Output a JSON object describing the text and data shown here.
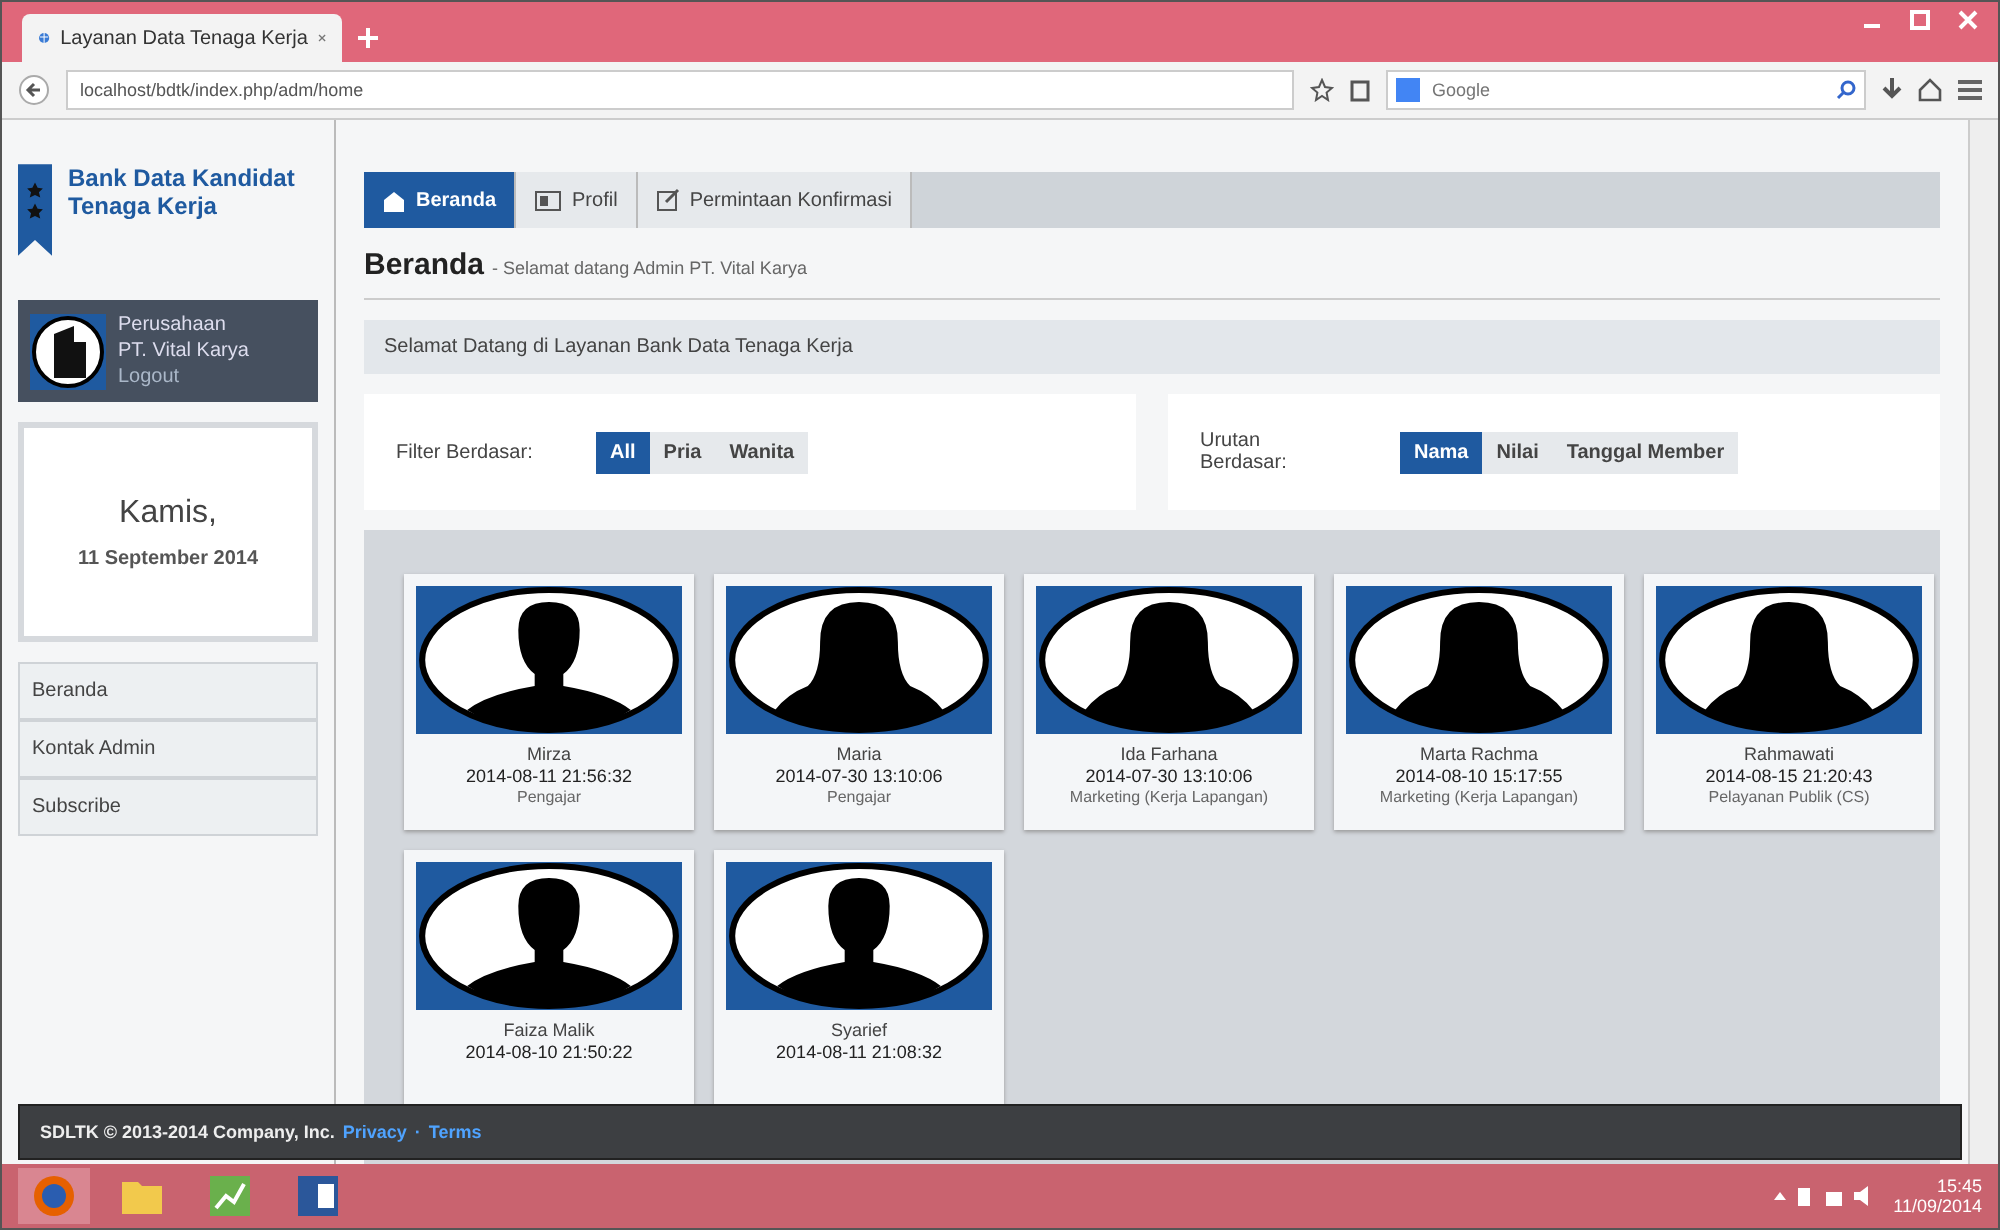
{
  "browser": {
    "tab_title": "Layanan Data Tenaga Kerja",
    "url": "localhost/bdtk/index.php/adm/home",
    "search_placeholder": "Google"
  },
  "sidebar": {
    "logo_title": "Bank Data Kandidat Tenaga Kerja",
    "company": {
      "label": "Perusahaan",
      "name": "PT. Vital Karya",
      "link": "Logout"
    },
    "date": {
      "day": "Kamis,",
      "date": "11 September 2014"
    },
    "menu": [
      {
        "label": "Beranda"
      },
      {
        "label": "Kontak Admin"
      },
      {
        "label": "Subscribe"
      }
    ]
  },
  "nav_tabs": [
    {
      "label": "Beranda",
      "selected": true,
      "kind": "home"
    },
    {
      "label": "Profil",
      "selected": false,
      "kind": "profile"
    },
    {
      "label": "Permintaan Konfirmasi",
      "selected": false,
      "kind": "edit"
    }
  ],
  "header": {
    "title": "Beranda",
    "subtitle": "- Selamat datang Admin PT. Vital Karya"
  },
  "welcome": "Selamat Datang di Layanan Bank Data Tenaga Kerja",
  "filter": {
    "label": "Filter Berdasar:",
    "options": [
      {
        "label": "All",
        "selected": true
      },
      {
        "label": "Pria",
        "selected": false
      },
      {
        "label": "Wanita",
        "selected": false
      }
    ]
  },
  "sort": {
    "label": "Urutan Berdasar:",
    "options": [
      {
        "label": "Nama",
        "selected": true
      },
      {
        "label": "Nilai",
        "selected": false
      },
      {
        "label": "Tanggal Member",
        "selected": false
      }
    ]
  },
  "candidates": [
    {
      "name": "Mirza",
      "date": "2014-08-11 21:56:32",
      "role": "Pengajar",
      "kind": "male"
    },
    {
      "name": "Maria",
      "date": "2014-07-30 13:10:06",
      "role": "Pengajar",
      "kind": "female"
    },
    {
      "name": "Ida Farhana",
      "date": "2014-07-30 13:10:06",
      "role": "Marketing (Kerja Lapangan)",
      "kind": "female"
    },
    {
      "name": "Marta Rachma",
      "date": "2014-08-10 15:17:55",
      "role": "Marketing (Kerja Lapangan)",
      "kind": "female"
    },
    {
      "name": "Rahmawati",
      "date": "2014-08-15 21:20:43",
      "role": "Pelayanan Publik (CS)",
      "kind": "female"
    },
    {
      "name": "Faiza Malik",
      "date": "2014-08-10 21:50:22",
      "kind": "male"
    },
    {
      "name": "Syarief",
      "date": "2014-08-11 21:08:32",
      "kind": "male"
    }
  ],
  "footer": {
    "text": "SDLTK © 2013-2014 Company, Inc.",
    "links": [
      "Privacy",
      "Terms"
    ],
    "separator": "·"
  },
  "taskbar": {
    "time": "15:45",
    "date": "11/09/2014"
  }
}
